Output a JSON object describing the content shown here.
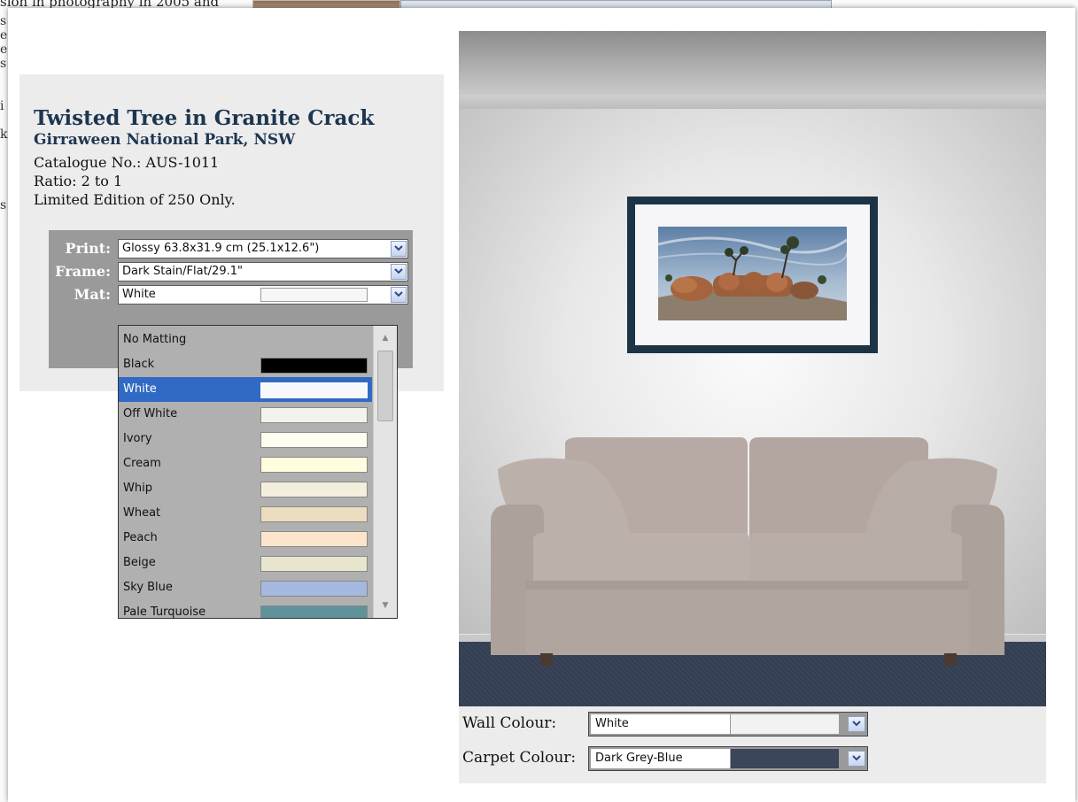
{
  "background_page": {
    "text_lines": [
      "sion in photography in 2005 and",
      "s",
      "e",
      "e",
      "s",
      "",
      "i",
      "",
      "k",
      "",
      "",
      "",
      "s"
    ]
  },
  "product": {
    "title": "Twisted Tree in Granite Crack",
    "location": "Girraween National Park, NSW",
    "catalogue": "Catalogue No.: AUS-1011",
    "ratio": "Ratio: 2 to 1",
    "edition": "Limited Edition of 250 Only."
  },
  "options": {
    "print": {
      "label": "Print:",
      "value": "Glossy 63.8x31.9 cm (25.1x12.6\")"
    },
    "frame": {
      "label": "Frame:",
      "value": "Dark Stain/Flat/29.1\""
    },
    "mat": {
      "label": "Mat:",
      "value": "White",
      "swatch": "#f6f6f6"
    }
  },
  "mat_dropdown": {
    "selected_index": 2,
    "items": [
      {
        "label": "No Matting",
        "color": ""
      },
      {
        "label": "Black",
        "color": "#000000"
      },
      {
        "label": "White",
        "color": "#f6f8fb"
      },
      {
        "label": "Off White",
        "color": "#f3f2ec"
      },
      {
        "label": "Ivory",
        "color": "#fdfcef"
      },
      {
        "label": "Cream",
        "color": "#fefede"
      },
      {
        "label": "Whip",
        "color": "#f4efdd"
      },
      {
        "label": "Wheat",
        "color": "#ecdcc0"
      },
      {
        "label": "Peach",
        "color": "#fbe6cb"
      },
      {
        "label": "Beige",
        "color": "#e7e5cd"
      },
      {
        "label": "Sky Blue",
        "color": "#a5b8e0"
      },
      {
        "label": "Pale Turquoise",
        "color": "#5f929a"
      }
    ]
  },
  "room_settings": {
    "wall": {
      "label": "Wall Colour:",
      "value": "White",
      "swatch": "#f2f2f2"
    },
    "carpet": {
      "label": "Carpet Colour:",
      "value": "Dark Grey-Blue",
      "swatch": "#3b465b"
    }
  },
  "colors": {
    "title": "#1d3650",
    "frame": "#1d3346",
    "selection": "#316ac5",
    "panel": "#ececec",
    "option_box": "#9a9a9a"
  },
  "icons": {
    "dropdown_button": "chevron-down-icon",
    "scroll_up": "scroll-up-arrow-icon",
    "scroll_down": "scroll-down-arrow-icon"
  }
}
